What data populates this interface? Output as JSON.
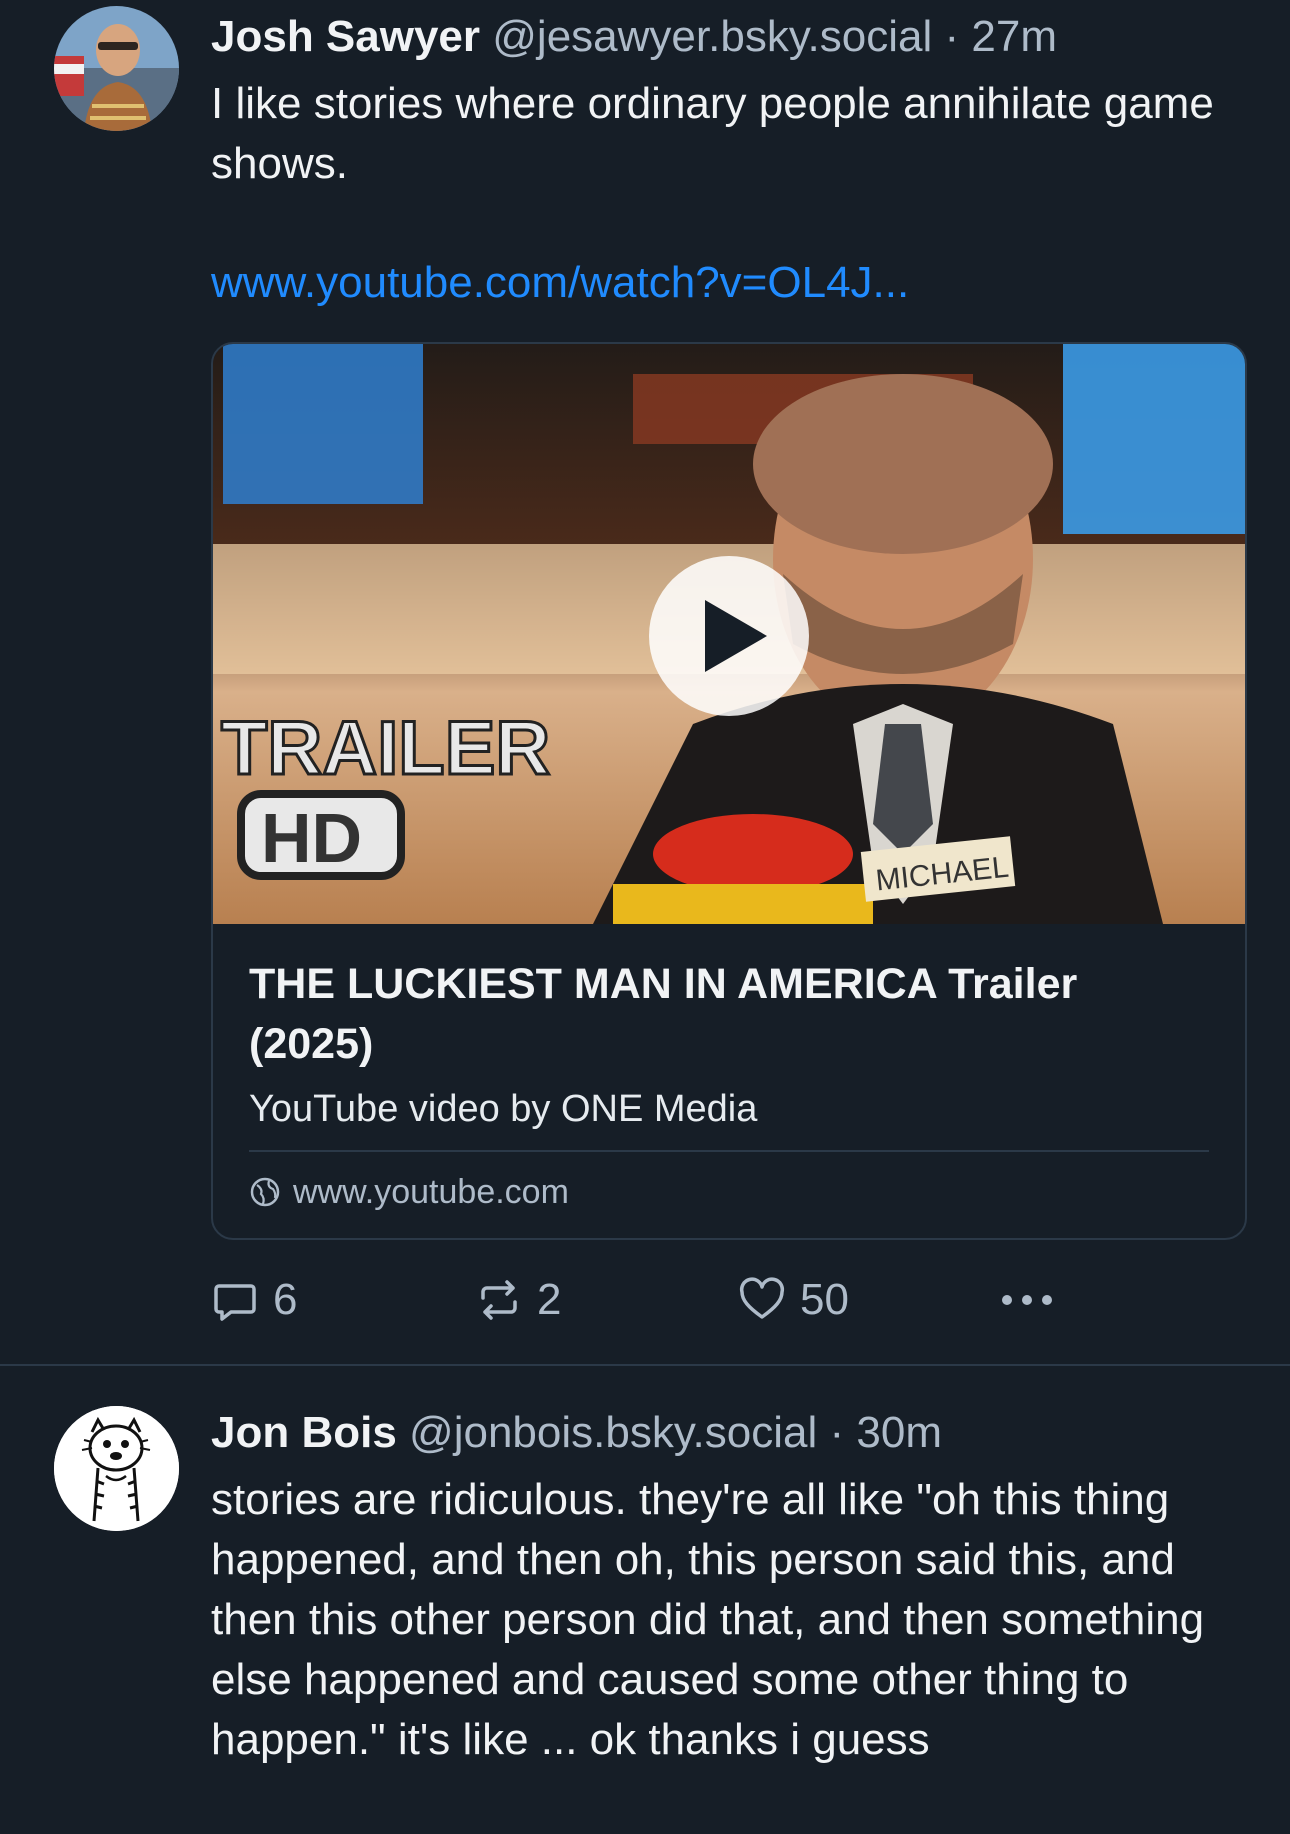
{
  "posts": [
    {
      "author": "Josh Sawyer",
      "handle": "@jesawyer.bsky.social",
      "separator": "·",
      "time": "27m",
      "text": "I like stories where ordinary people annihilate game shows.",
      "link": "www.youtube.com/watch?v=OL4J...",
      "embed": {
        "thumbnail_overlay_1": "TRAILER",
        "thumbnail_overlay_2": "HD",
        "nameplate": "MICHAEL",
        "title": "THE LUCKIEST MAN IN AMERICA Trailer (2025)",
        "description": "YouTube video by ONE Media",
        "domain": "www.youtube.com"
      },
      "counts": {
        "replies": "6",
        "reposts": "2",
        "likes": "50"
      }
    },
    {
      "author": "Jon Bois",
      "handle": "@jonbois.bsky.social",
      "separator": "·",
      "time": "30m",
      "text": "stories are ridiculous. they're all like \"oh this thing happened, and then oh, this person said this, and then this other person did that, and then something else happened and caused some other thing to happen.\" it's like ... ok thanks i guess"
    }
  ],
  "icons": {
    "reply": "speech-bubble-icon",
    "repost": "repost-arrows-icon",
    "like": "heart-icon",
    "more": "ellipsis-icon",
    "globe": "globe-icon",
    "play": "play-icon"
  },
  "colors": {
    "background": "#161e27",
    "link": "#208bfe",
    "muted": "#aebbc9",
    "divider": "#2b3948"
  }
}
